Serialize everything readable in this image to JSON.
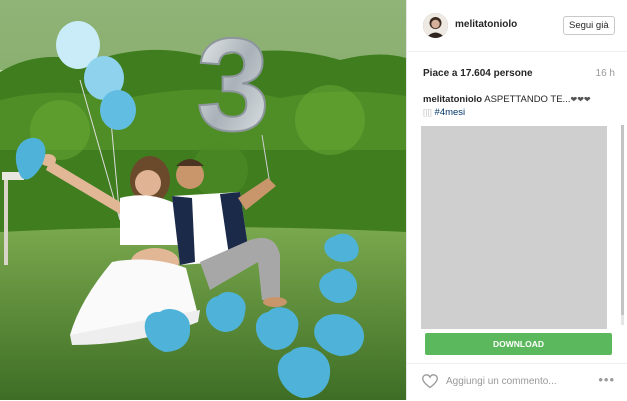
{
  "post": {
    "username": "melitatoniolo",
    "follow_label": "Segui già",
    "likes": "Piace a 17.604 persone",
    "time_ago": "16 h",
    "caption_username": "melitatoniolo",
    "caption_text": "ASPETTANDO TE...",
    "caption_hearts": "❤❤❤",
    "hashtag": "#4mesi",
    "faint_text": "[][]",
    "ghost_line_1": "",
    "ghost_line_2": "",
    "ghost_line_3": "",
    "download_label": "DOWNLOAD",
    "comment_placeholder": "Aggiungi un commento...",
    "more_label": "•••",
    "photo_number": "3"
  },
  "colors": {
    "balloon": "#4fb3d9",
    "download": "#5cb85c",
    "hedge": "#3f7d1f"
  },
  "icons": {
    "heart": "heart-outline-icon",
    "more": "more-options-icon"
  }
}
